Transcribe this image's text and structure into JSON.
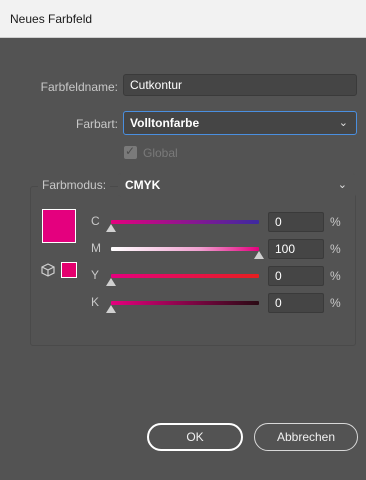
{
  "window": {
    "title": "Neues Farbfeld"
  },
  "form": {
    "name_label": "Farbfeldname:",
    "name_value": "Cutkontur",
    "type_label": "Farbart:",
    "type_value": "Volltonfarbe",
    "global_label": "Global",
    "global_checked": true,
    "global_disabled": true,
    "mode_label": "Farbmodus:",
    "mode_value": "CMYK"
  },
  "channels": [
    {
      "label": "C",
      "value": "0",
      "unit": "%",
      "level": 0
    },
    {
      "label": "M",
      "value": "100",
      "unit": "%",
      "level": 100
    },
    {
      "label": "Y",
      "value": "0",
      "unit": "%",
      "level": 0
    },
    {
      "label": "K",
      "value": "0",
      "unit": "%",
      "level": 0
    }
  ],
  "swatch": {
    "color": "#e4007e",
    "gamut_color": "#e4006e"
  },
  "icons": {
    "dropdown": "chevron-down-icon",
    "gamut": "cube-icon",
    "check": "checkmark-icon"
  },
  "buttons": {
    "ok_label": "OK",
    "cancel_label": "Abbrechen"
  }
}
